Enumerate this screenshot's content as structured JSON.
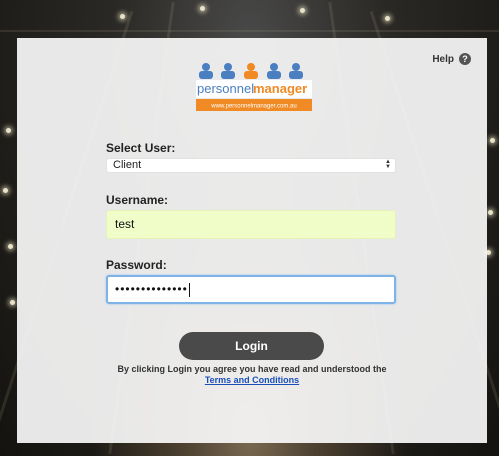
{
  "header": {
    "help_label": "Help",
    "help_icon_glyph": "?"
  },
  "logo": {
    "brand_word_1": "personnel",
    "brand_word_2": "manager",
    "url": "www.personnelmanager.com.au",
    "colors": {
      "blue": "#4a7fc1",
      "orange": "#f08a24"
    }
  },
  "form": {
    "select_user_label": "Select User:",
    "select_user_value": "Client",
    "username_label": "Username:",
    "username_value": "test",
    "password_label": "Password:",
    "password_masked": "••••••••••••••",
    "login_button_label": "Login"
  },
  "footer": {
    "agreement_text": "By clicking Login you agree you have read and understood the",
    "terms_link_label": "Terms and Conditions"
  }
}
